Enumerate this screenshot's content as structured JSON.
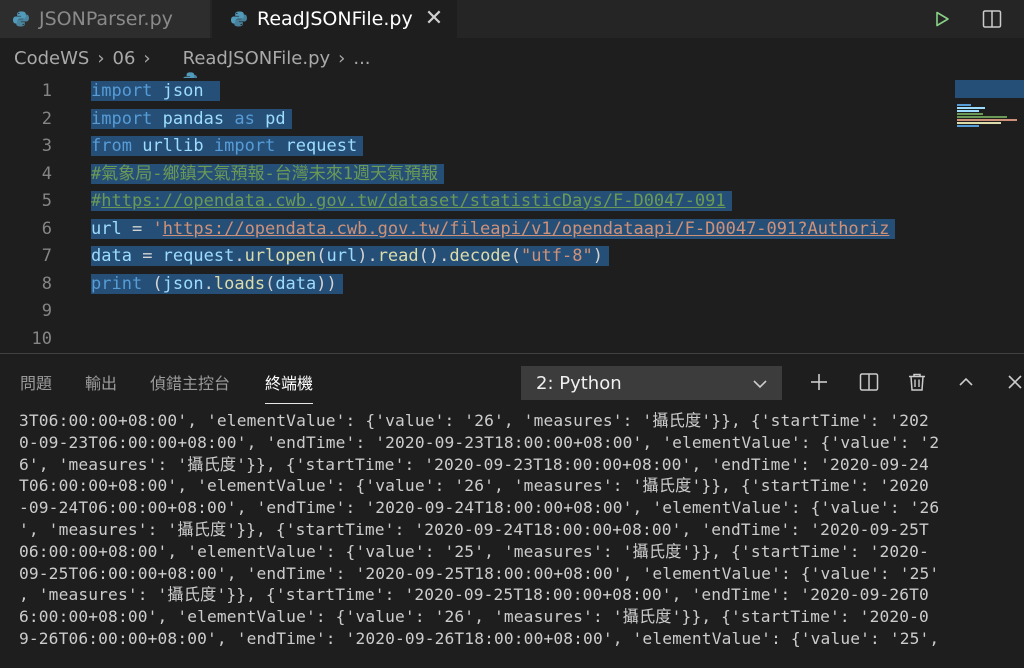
{
  "tabs": [
    {
      "label": "JSONParser.py",
      "active": false
    },
    {
      "label": "ReadJSONFile.py",
      "active": true
    }
  ],
  "breadcrumb": {
    "parts": [
      "CodeWS",
      "06",
      "ReadJSONFile.py",
      "..."
    ]
  },
  "editor": {
    "line_numbers": [
      "1",
      "2",
      "3",
      "4",
      "5",
      "6",
      "7",
      "8",
      "9",
      "10"
    ],
    "lines": {
      "l1": {
        "kw": "import",
        "mod": "json"
      },
      "l2": {
        "kw1": "import",
        "mod": "pandas",
        "kw2": "as",
        "alias": "pd"
      },
      "l3": {
        "kw1": "from",
        "mod": "urllib",
        "kw2": "import",
        "name": "request"
      },
      "l4": {
        "comment": "#氣象局-鄉鎮天氣預報-台灣未來1週天氣預報"
      },
      "l5": {
        "comment_prefix": "#",
        "comment_url": "https://opendata.cwb.gov.tw/dataset/statisticDays/F-D0047-091"
      },
      "l6": {
        "var": "url",
        "op": " = ",
        "quote": "'",
        "url": "https://opendata.cwb.gov.tw/fileapi/v1/opendataapi/F-D0047-091?Authoriz"
      },
      "l7": {
        "var": "data",
        "op": " = ",
        "obj": "request",
        "call1": "urlopen",
        "arg": "url",
        "call2": "read",
        "call3": "decode",
        "str": "\"utf-8\""
      },
      "l8": {
        "fn": "print",
        "rest1": " (",
        "obj": "json",
        "call": "loads",
        "arg": "data",
        "rest2": "))"
      }
    }
  },
  "panel": {
    "tabs": [
      "問題",
      "輸出",
      "偵錯主控台",
      "終端機"
    ],
    "active_tab": "終端機",
    "terminal_select": "2: Python",
    "terminal_lines": [
      "3T06:00:00+08:00', 'elementValue': {'value': '26', 'measures': '攝氏度'}}, {'startTime': '202",
      "0-09-23T06:00:00+08:00', 'endTime': '2020-09-23T18:00:00+08:00', 'elementValue': {'value': '2",
      "6', 'measures': '攝氏度'}}, {'startTime': '2020-09-23T18:00:00+08:00', 'endTime': '2020-09-24",
      "T06:00:00+08:00', 'elementValue': {'value': '26', 'measures': '攝氏度'}}, {'startTime': '2020",
      "-09-24T06:00:00+08:00', 'endTime': '2020-09-24T18:00:00+08:00', 'elementValue': {'value': '26",
      "', 'measures': '攝氏度'}}, {'startTime': '2020-09-24T18:00:00+08:00', 'endTime': '2020-09-25T",
      "06:00:00+08:00', 'elementValue': {'value': '25', 'measures': '攝氏度'}}, {'startTime': '2020-",
      "09-25T06:00:00+08:00', 'endTime': '2020-09-25T18:00:00+08:00', 'elementValue': {'value': '25'",
      ", 'measures': '攝氏度'}}, {'startTime': '2020-09-25T18:00:00+08:00', 'endTime': '2020-09-26T0",
      "6:00:00+08:00', 'elementValue': {'value': '26', 'measures': '攝氏度'}}, {'startTime': '2020-0",
      "9-26T06:00:00+08:00', 'endTime': '2020-09-26T18:00:00+08:00', 'elementValue': {'value': '25',"
    ]
  },
  "colors": {
    "keyword": "#569cd6",
    "identifier": "#9cdcfe",
    "function": "#dcdcaa",
    "string": "#ce9178",
    "comment": "#6a9955",
    "selection": "#264f78",
    "python_icon": "#519aba"
  },
  "icons": {
    "tab_file": "python-icon",
    "run": "play-icon",
    "split": "split-editor-icon",
    "close_tab": "close-icon",
    "new_terminal": "plus-icon",
    "split_terminal": "split-terminal-icon",
    "kill_terminal": "trash-icon",
    "maximize": "chevron-up-icon",
    "close_panel": "close-icon"
  }
}
